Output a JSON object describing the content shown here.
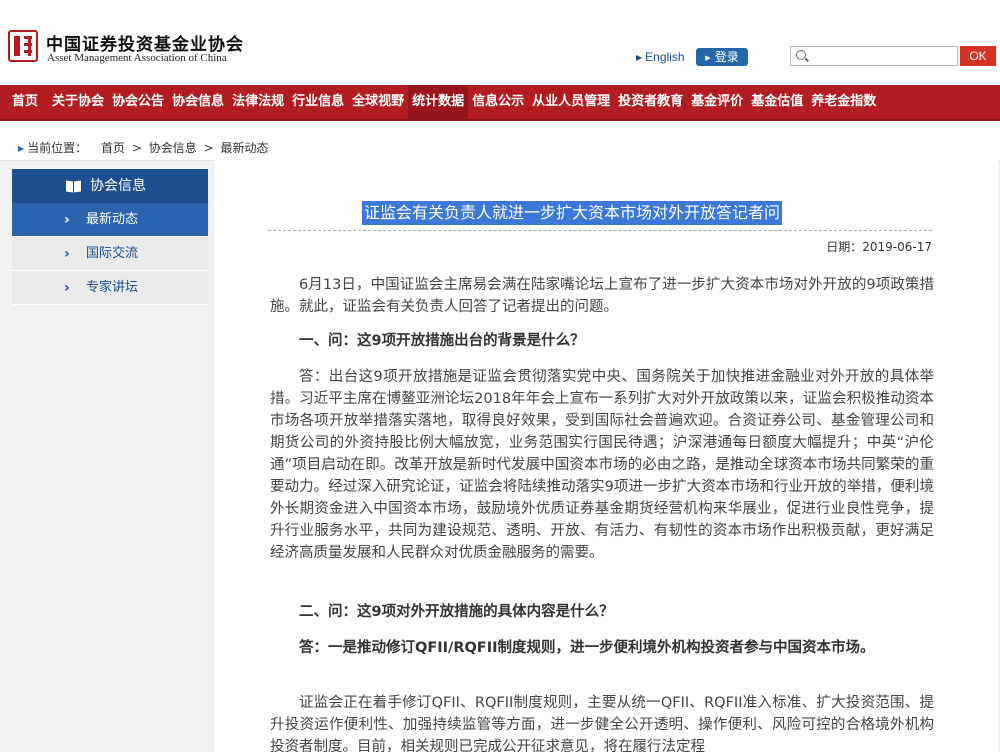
{
  "header": {
    "org_name_cn": "中国证券投资基金业协会",
    "org_name_en": "Asset Management Association of China",
    "english_link": "English",
    "login_label": "登录",
    "search_placeholder": "",
    "search_button": "OK"
  },
  "nav": {
    "items": [
      "首页",
      "关于协会",
      "协会公告",
      "协会信息",
      "法律法规",
      "行业信息",
      "全球视野",
      "统计数据",
      "信息公示",
      "从业人员管理",
      "投资者教育",
      "基金评价",
      "基金估值",
      "养老金指数"
    ],
    "active_index": 7
  },
  "breadcrumb": {
    "prefix": "当前位置：",
    "items": [
      "首页",
      "协会信息",
      "最新动态"
    ],
    "separator": ">"
  },
  "sidebar": {
    "title": "协会信息",
    "items": [
      {
        "label": "最新动态",
        "active": true
      },
      {
        "label": "国际交流",
        "active": false
      },
      {
        "label": "专家讲坛",
        "active": false
      }
    ]
  },
  "article": {
    "title": "证监会有关负责人就进一步扩大资本市场对外开放答记者问",
    "date": "日期：2019-06-17",
    "paragraphs": [
      "6月13日，中国证监会主席易会满在陆家嘴论坛上宣布了进一步扩大资本市场对外开放的9项政策措施。就此，证监会有关负责人回答了记者提出的问题。",
      "一、问：这9项开放措施出台的背景是什么？",
      "答：出台这9项开放措施是证监会贯彻落实党中央、国务院关于加快推进金融业对外开放的具体举措。习近平主席在博鳌亚洲论坛2018年年会上宣布一系列扩大对外开放政策以来，证监会积极推动资本市场各项开放举措落实落地，取得良好效果，受到国际社会普遍欢迎。合资证券公司、基金管理公司和期货公司的外资持股比例大幅放宽，业务范围实行国民待遇；沪深港通每日额度大幅提升；中英“沪伦通”项目启动在即。改革开放是新时代发展中国资本市场的必由之路，是推动全球资本市场共同繁荣的重要动力。经过深入研究论证，证监会将陆续推动落实9项进一步扩大资本市场和行业开放的举措，便利境外长期资金进入中国资本市场，鼓励境外优质证券基金期货经营机构来华展业，促进行业良性竞争，提升行业服务水平，共同为建设规范、透明、开放、有活力、有韧性的资本市场作出积极贡献，更好满足经济高质量发展和人民群众对优质金融服务的需要。",
      "二、问：这9项对外开放措施的具体内容是什么？",
      "答：一是推动修订QFII/RQFII制度规则，进一步便利境外机构投资者参与中国资本市场。",
      "证监会正在着手修订QFII、RQFII制度规则，主要从统一QFII、RQFII准入标准、扩大投资范围、提升投资运作便利性、加强持续监管等方面，进一步健全公开透明、操作便利、风险可控的合格境外机构投资者制度。目前，相关规则已完成公开征求意见，将在履行法定程"
    ]
  },
  "colors": {
    "brand_red": "#b21d22",
    "sidebar_blue": "#1d4f91",
    "title_highlight": "#3b78d7"
  }
}
